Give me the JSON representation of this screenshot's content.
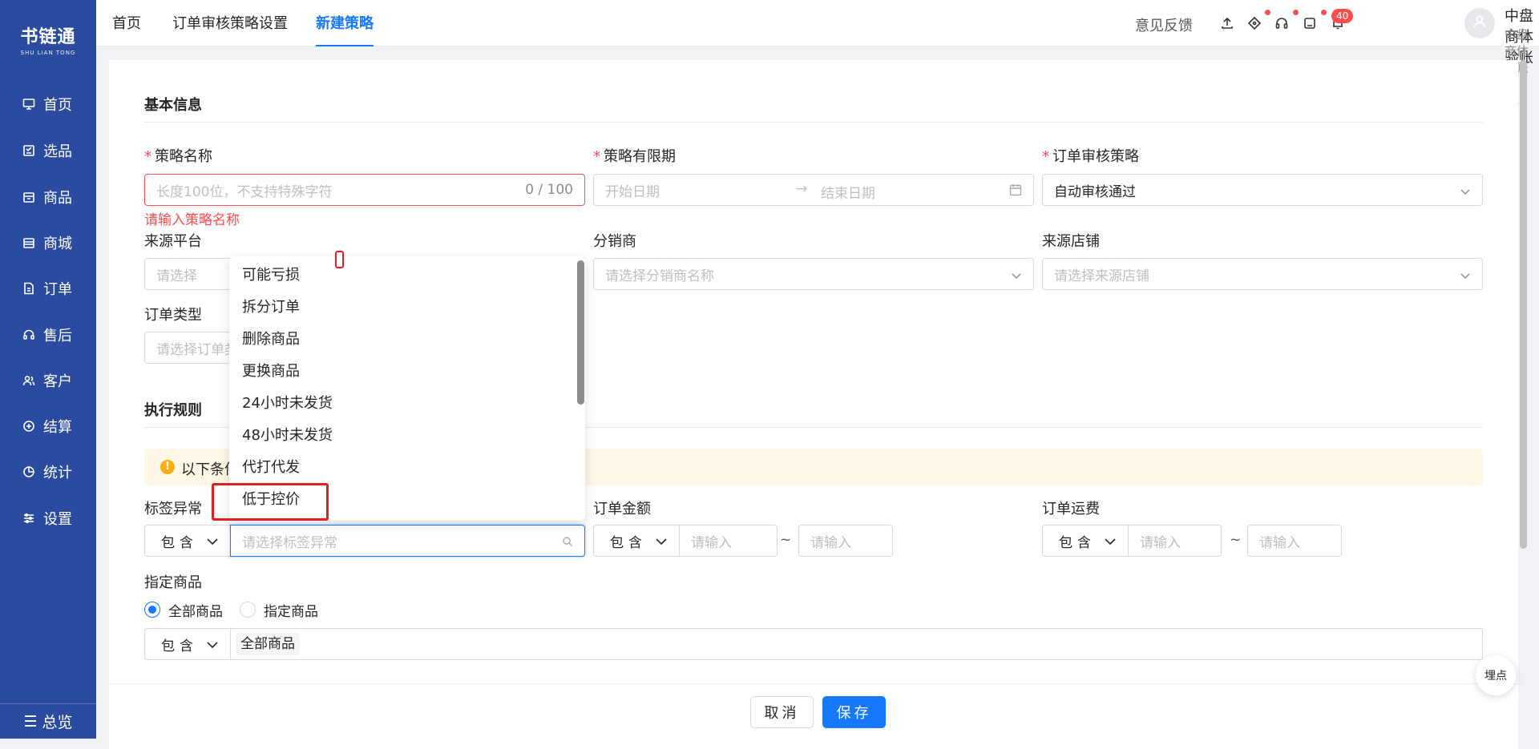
{
  "app": {
    "logo_cn": "书链通",
    "logo_en": "SHU LIAN TONG"
  },
  "sidebar": {
    "items": [
      {
        "label": "首页",
        "icon": "monitor-icon"
      },
      {
        "label": "选品",
        "icon": "checklist-icon"
      },
      {
        "label": "商品",
        "icon": "box-icon"
      },
      {
        "label": "商城",
        "icon": "store-icon"
      },
      {
        "label": "订单",
        "icon": "order-icon"
      },
      {
        "label": "售后",
        "icon": "headset-icon"
      },
      {
        "label": "客户",
        "icon": "users-icon"
      },
      {
        "label": "结算",
        "icon": "settle-icon"
      },
      {
        "label": "统计",
        "icon": "pie-icon"
      },
      {
        "label": "设置",
        "icon": "sliders-icon"
      }
    ],
    "bottom_label": "总览"
  },
  "topbar": {
    "tabs": [
      "首页",
      "订单审核策略设置",
      "新建策略"
    ],
    "active_tab": "新建策略",
    "feedback": "意见反馈",
    "badge_count": "40",
    "user_name": "中盘商体验账号",
    "user_sub": "中盘商体验账号111"
  },
  "basic": {
    "title": "基本信息",
    "name_label": "策略名称",
    "name_placeholder": "长度100位，不支持特殊字符",
    "name_count": "0 / 100",
    "name_error": "请输入策略名称",
    "period_label": "策略有限期",
    "start_placeholder": "开始日期",
    "end_placeholder": "结束日期",
    "audit_label": "订单审核策略",
    "audit_value": "自动审核通过",
    "platform_label": "来源平台",
    "platform_placeholder": "请选择",
    "distributor_label": "分销商",
    "distributor_placeholder": "请选择分销商名称",
    "shop_label": "来源店铺",
    "shop_placeholder": "请选择来源店铺",
    "ordertype_label": "订单类型",
    "ordertype_placeholder": "请选择订单类"
  },
  "rules": {
    "title": "执行规则",
    "alert_text": "以下条件",
    "tag_label": "标签异常",
    "tag_op": "包含",
    "tag_placeholder": "请选择标签异常",
    "amount_label": "订单金额",
    "amount_op": "包含",
    "amount_min_ph": "请输入",
    "amount_max_ph": "请输入",
    "tilde": "~",
    "freight_label": "订单运费",
    "freight_op": "包含",
    "freight_min_ph": "请输入",
    "freight_max_ph": "请输入",
    "product_label": "指定商品",
    "radio_all": "全部商品",
    "radio_specified": "指定商品",
    "radio_selected": "全部商品",
    "product_op": "包含",
    "product_tag": "全部商品"
  },
  "dropdown": {
    "options": [
      "可能亏损",
      "拆分订单",
      "删除商品",
      "更换商品",
      "24小时未发货",
      "48小时未发货",
      "代打代发",
      "低于控价"
    ],
    "highlighted": "低于控价"
  },
  "footer": {
    "cancel": "取消",
    "save": "保存"
  },
  "float_button": "埋点",
  "colors": {
    "sidebar": "#2a4ba0",
    "primary": "#1677ff",
    "error": "#ff4d4f",
    "alert_bg": "#fff8e6"
  }
}
